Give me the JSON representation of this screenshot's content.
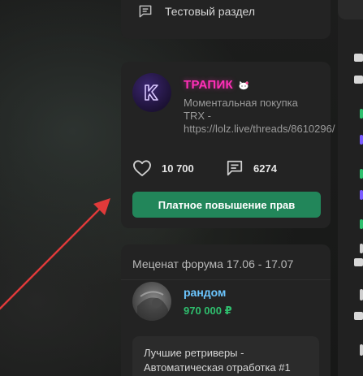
{
  "top_menu": {
    "label": "Тестовый раздел",
    "icon": "chat-bubble-icon"
  },
  "ad": {
    "avatar_letter": "K",
    "name": "ТРАПИК",
    "badge_icon": "hello-kitty-icon",
    "description": "Моментальная покупка TRX - https://lolz.live/threads/8610296/",
    "likes": "10 700",
    "messages": "6274",
    "button_label": "Платное повышение прав",
    "colors": {
      "name": "#ff2fb8",
      "button": "#22865a"
    }
  },
  "patron": {
    "title": "Меценат форума 17.06 - 17.07",
    "name": "рандом",
    "amount": "970 000 ₽",
    "thread_title": "Лучшие ретриверы - Автоматическая отработка #1",
    "colors": {
      "name": "#6cc6ff",
      "amount": "#2fbf6e"
    }
  },
  "annotation": {
    "arrow_color": "#e03a3a"
  }
}
